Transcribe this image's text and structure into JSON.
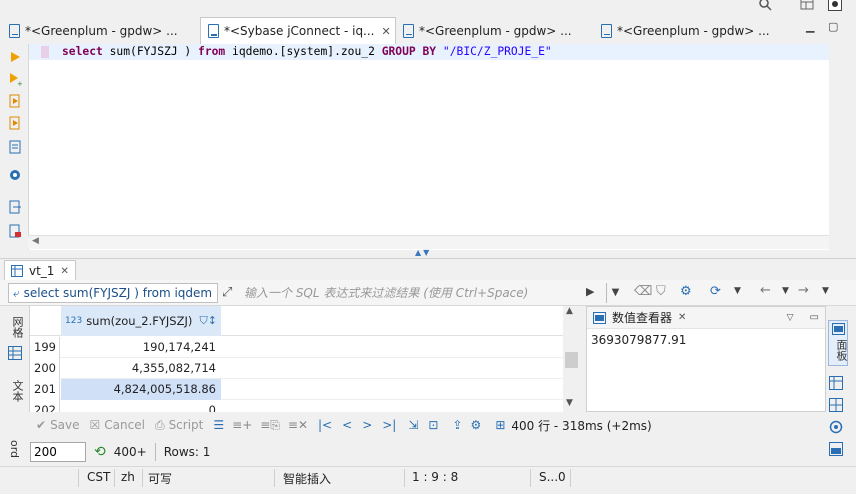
{
  "tabs": [
    {
      "label": "*<Greenplum - gpdw> ..."
    },
    {
      "label": "*<Sybase jConnect - iq...",
      "active": true
    },
    {
      "label": "*<Greenplum - gpdw> ..."
    },
    {
      "label": "*<Greenplum - gpdw> ..."
    }
  ],
  "editor": {
    "sql_kw1": "select",
    "sql_p1": " sum(FYJSZJ ) ",
    "sql_kw2": "from",
    "sql_p2": " iqdemo.[system].zou_2 ",
    "sql_kw3": "GROUP BY",
    "sql_str": " \"/BIC/Z_PROJE_E\""
  },
  "results": {
    "tab_label": "vt_1",
    "filter_query": "select sum(FYJSZJ ) from iqdem",
    "filter_placeholder": "输入一个 SQL 表达式来过滤结果 (使用 Ctrl+Space)",
    "column_header": "sum(zou_2.FYJSZJ)",
    "rows": [
      {
        "num": "199",
        "value": "190,174,241"
      },
      {
        "num": "200",
        "value": "4,355,082,714"
      },
      {
        "num": "201",
        "value": "4,824,005,518.86"
      },
      {
        "num": "202",
        "value": "0"
      }
    ],
    "side_labels": {
      "grid": "网格",
      "text": "文本",
      "record": "ord"
    }
  },
  "viewer": {
    "title": "数值查看器",
    "value": "3693079877.91",
    "side_label": "面板"
  },
  "bottombar": {
    "save": "Save",
    "cancel": "Cancel",
    "script": "Script",
    "stats": "400 行 - 318ms (+2ms)"
  },
  "pagebar": {
    "fetch_size": "200",
    "fetch_next": "400+",
    "rows": "Rows: 1"
  },
  "statusbar": {
    "tz": "CST",
    "locale": "zh",
    "mode": "可写",
    "insert": "智能插入",
    "position": "1 : 9 : 8",
    "extra": "S...0"
  },
  "colors": {
    "accent": "#2a6fb3",
    "keyword": "#7f0055",
    "string": "#2a00ff",
    "selection": "#cfe0f7"
  }
}
